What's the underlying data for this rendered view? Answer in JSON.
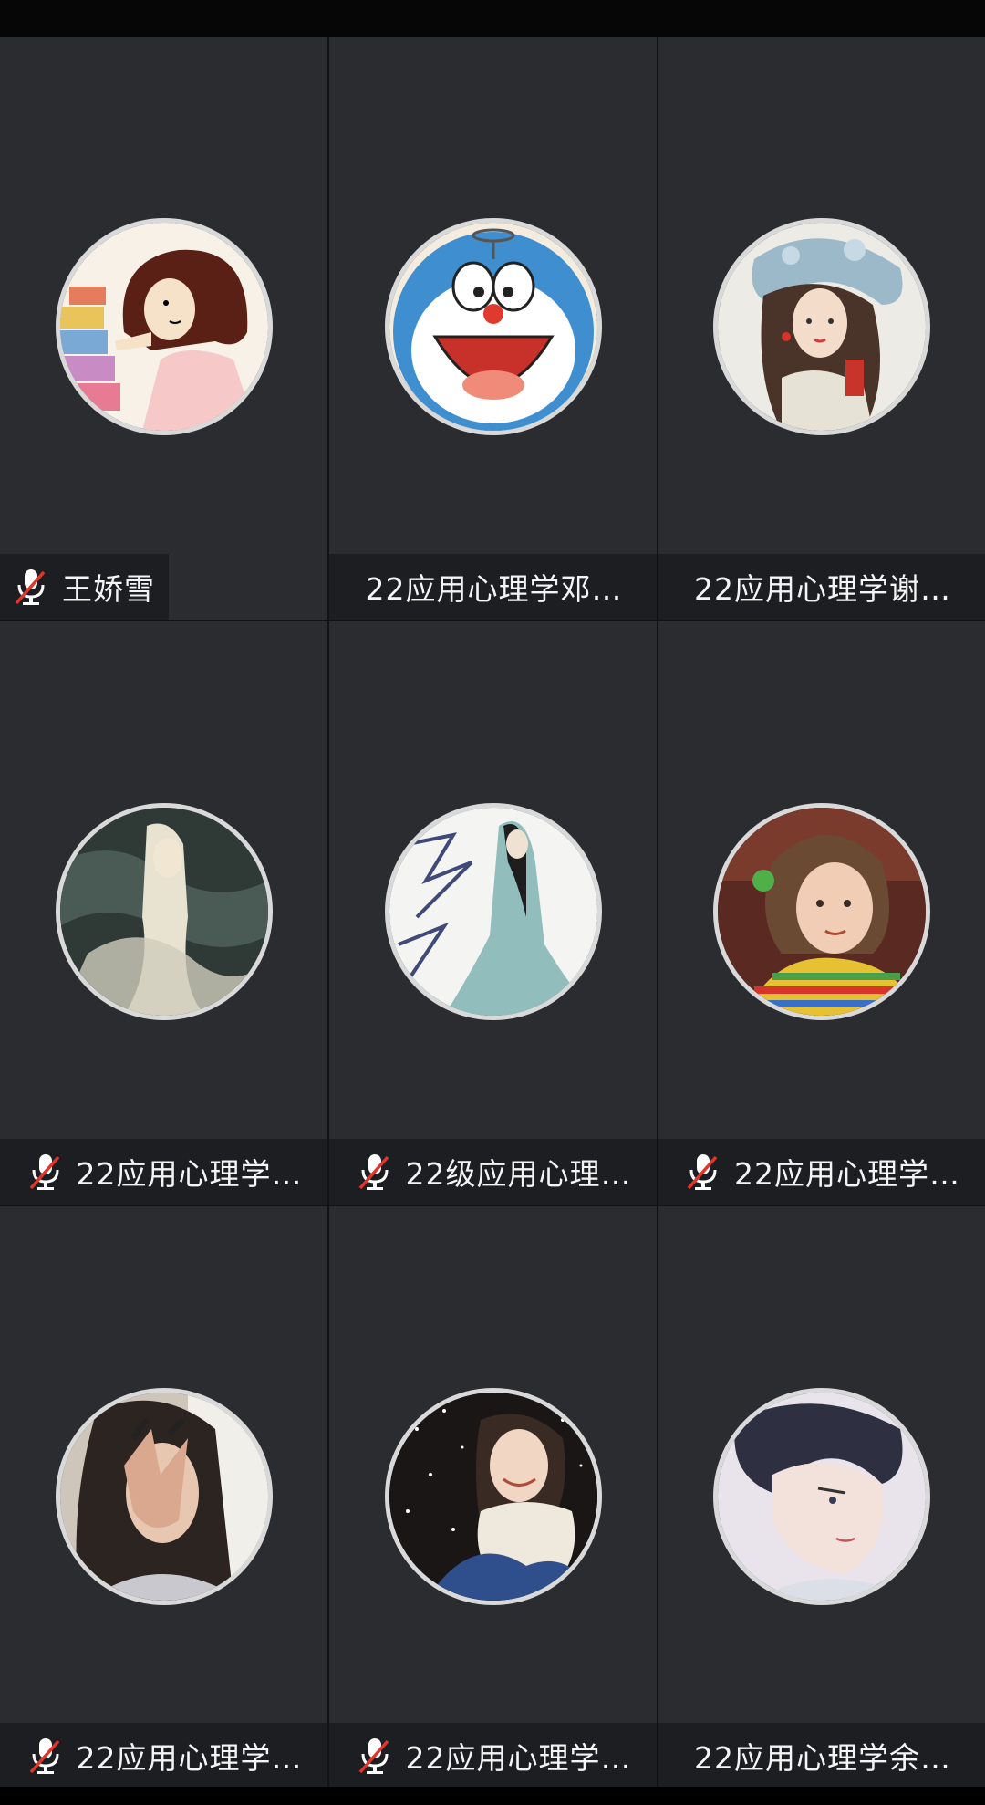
{
  "participants": [
    {
      "name": "王娇雪",
      "muted": true,
      "avatar_icon": "cartoon-girl-avatar-icon"
    },
    {
      "name": "22应用心理学邓…",
      "muted": false,
      "avatar_icon": "doraemon-avatar-icon"
    },
    {
      "name": "22应用心理学谢…",
      "muted": false,
      "avatar_icon": "opera-girl-avatar-icon"
    },
    {
      "name": "22应用心理学…",
      "muted": true,
      "avatar_icon": "white-hair-girl-avatar-icon"
    },
    {
      "name": "22级应用心理…",
      "muted": true,
      "avatar_icon": "ink-painting-girl-avatar-icon"
    },
    {
      "name": "22应用心理学…",
      "muted": true,
      "avatar_icon": "child-photo-avatar-icon"
    },
    {
      "name": "22应用心理学…",
      "muted": true,
      "avatar_icon": "hidden-face-girl-avatar-icon"
    },
    {
      "name": "22应用心理学…",
      "muted": true,
      "avatar_icon": "snow-girl-avatar-icon"
    },
    {
      "name": "22应用心理学余…",
      "muted": false,
      "avatar_icon": "anime-boy-avatar-icon"
    }
  ],
  "colors": {
    "tile_bg": "#2a2c30",
    "nameplate_bg": "#1d1e21",
    "mute_slash": "#e0352b"
  }
}
